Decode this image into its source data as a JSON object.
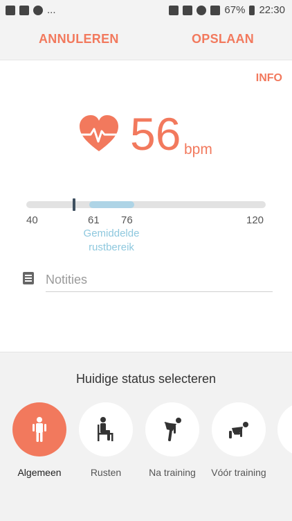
{
  "status_bar": {
    "battery": "67%",
    "time": "22:30",
    "more": "..."
  },
  "actions": {
    "cancel": "ANNULEREN",
    "save": "OPSLAAN",
    "info": "INFO"
  },
  "reading": {
    "value": "56",
    "unit": "bpm"
  },
  "range": {
    "min_label": "40",
    "rest_start_label": "61",
    "rest_end_label": "76",
    "max_label": "120",
    "rest_label_line1": "Gemiddelde",
    "rest_label_line2": "rustbereik",
    "min": 40,
    "max": 120,
    "rest_start": 61,
    "rest_end": 76,
    "current": 56
  },
  "notes": {
    "placeholder": "Notities"
  },
  "status_section": {
    "title": "Huidige status selecteren",
    "options": [
      {
        "label": "Algemeen",
        "icon": "person-standing-icon",
        "selected": true
      },
      {
        "label": "Rusten",
        "icon": "person-sitting-icon",
        "selected": false
      },
      {
        "label": "Na training",
        "icon": "person-bending-icon",
        "selected": false
      },
      {
        "label": "Vóór training",
        "icon": "person-starting-icon",
        "selected": false
      }
    ]
  },
  "colors": {
    "accent": "#f2795d",
    "rest_range": "#aed4e6",
    "marker": "#3f5060"
  }
}
